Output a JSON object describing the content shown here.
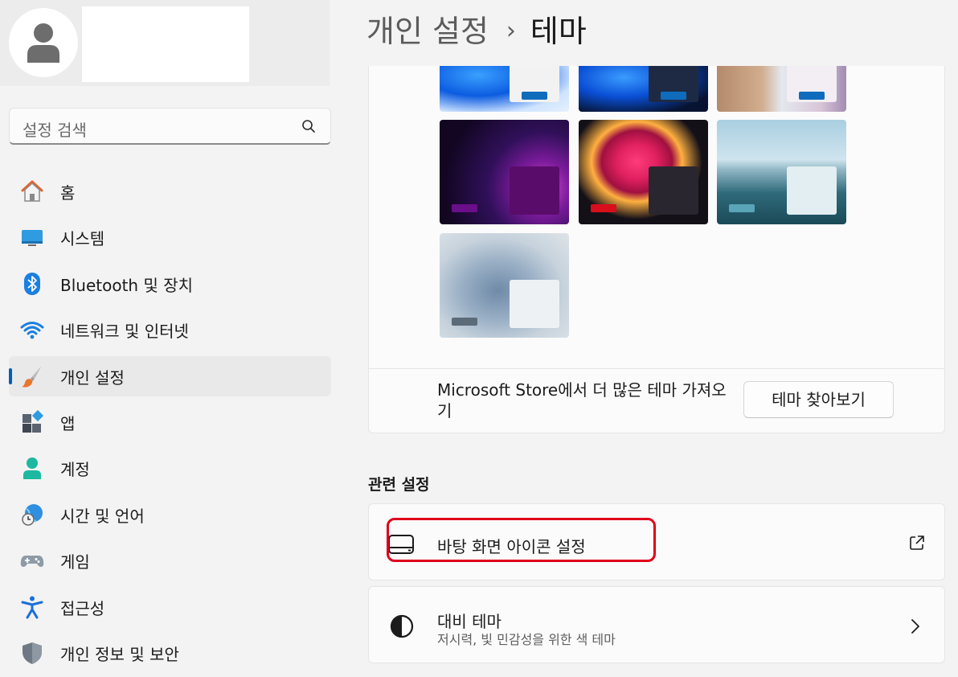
{
  "sidebar": {
    "search": {
      "placeholder": "설정 검색"
    },
    "items": [
      {
        "label": "홈",
        "icon": "home-icon"
      },
      {
        "label": "시스템",
        "icon": "system-icon"
      },
      {
        "label": "Bluetooth 및 장치",
        "icon": "bluetooth-icon"
      },
      {
        "label": "네트워크 및 인터넷",
        "icon": "wifi-icon"
      },
      {
        "label": "개인 설정",
        "icon": "brush-icon",
        "active": true
      },
      {
        "label": "앱",
        "icon": "apps-icon"
      },
      {
        "label": "계정",
        "icon": "account-icon"
      },
      {
        "label": "시간 및 언어",
        "icon": "time-language-icon"
      },
      {
        "label": "게임",
        "icon": "gamepad-icon"
      },
      {
        "label": "접근성",
        "icon": "accessibility-icon"
      },
      {
        "label": "개인 정보 및 보안",
        "icon": "shield-icon"
      }
    ]
  },
  "header": {
    "parent": "개인 설정",
    "separator": "›",
    "current": "테마"
  },
  "themes": {
    "store_text": "Microsoft Store에서 더 많은 테마 가져오기",
    "browse_label": "테마 찾아보기",
    "accent_colors": [
      "#0f6cbd",
      "#0f6cbd",
      "#0f6cbd",
      "#6a0e8a",
      "#d80e1c",
      "#5aa5b8",
      "#5b6b78"
    ]
  },
  "related": {
    "title": "관련 설정",
    "desktop_icons": {
      "label": "바탕 화면 아이콘 설정",
      "icon": "desktop-icon",
      "trail_icon": "open-external-icon"
    },
    "contrast": {
      "label": "대비 테마",
      "sub": "저시력, 빛 민감성을 위한 색 테마",
      "icon": "contrast-icon",
      "trail_icon": "chevron-right-icon"
    }
  }
}
